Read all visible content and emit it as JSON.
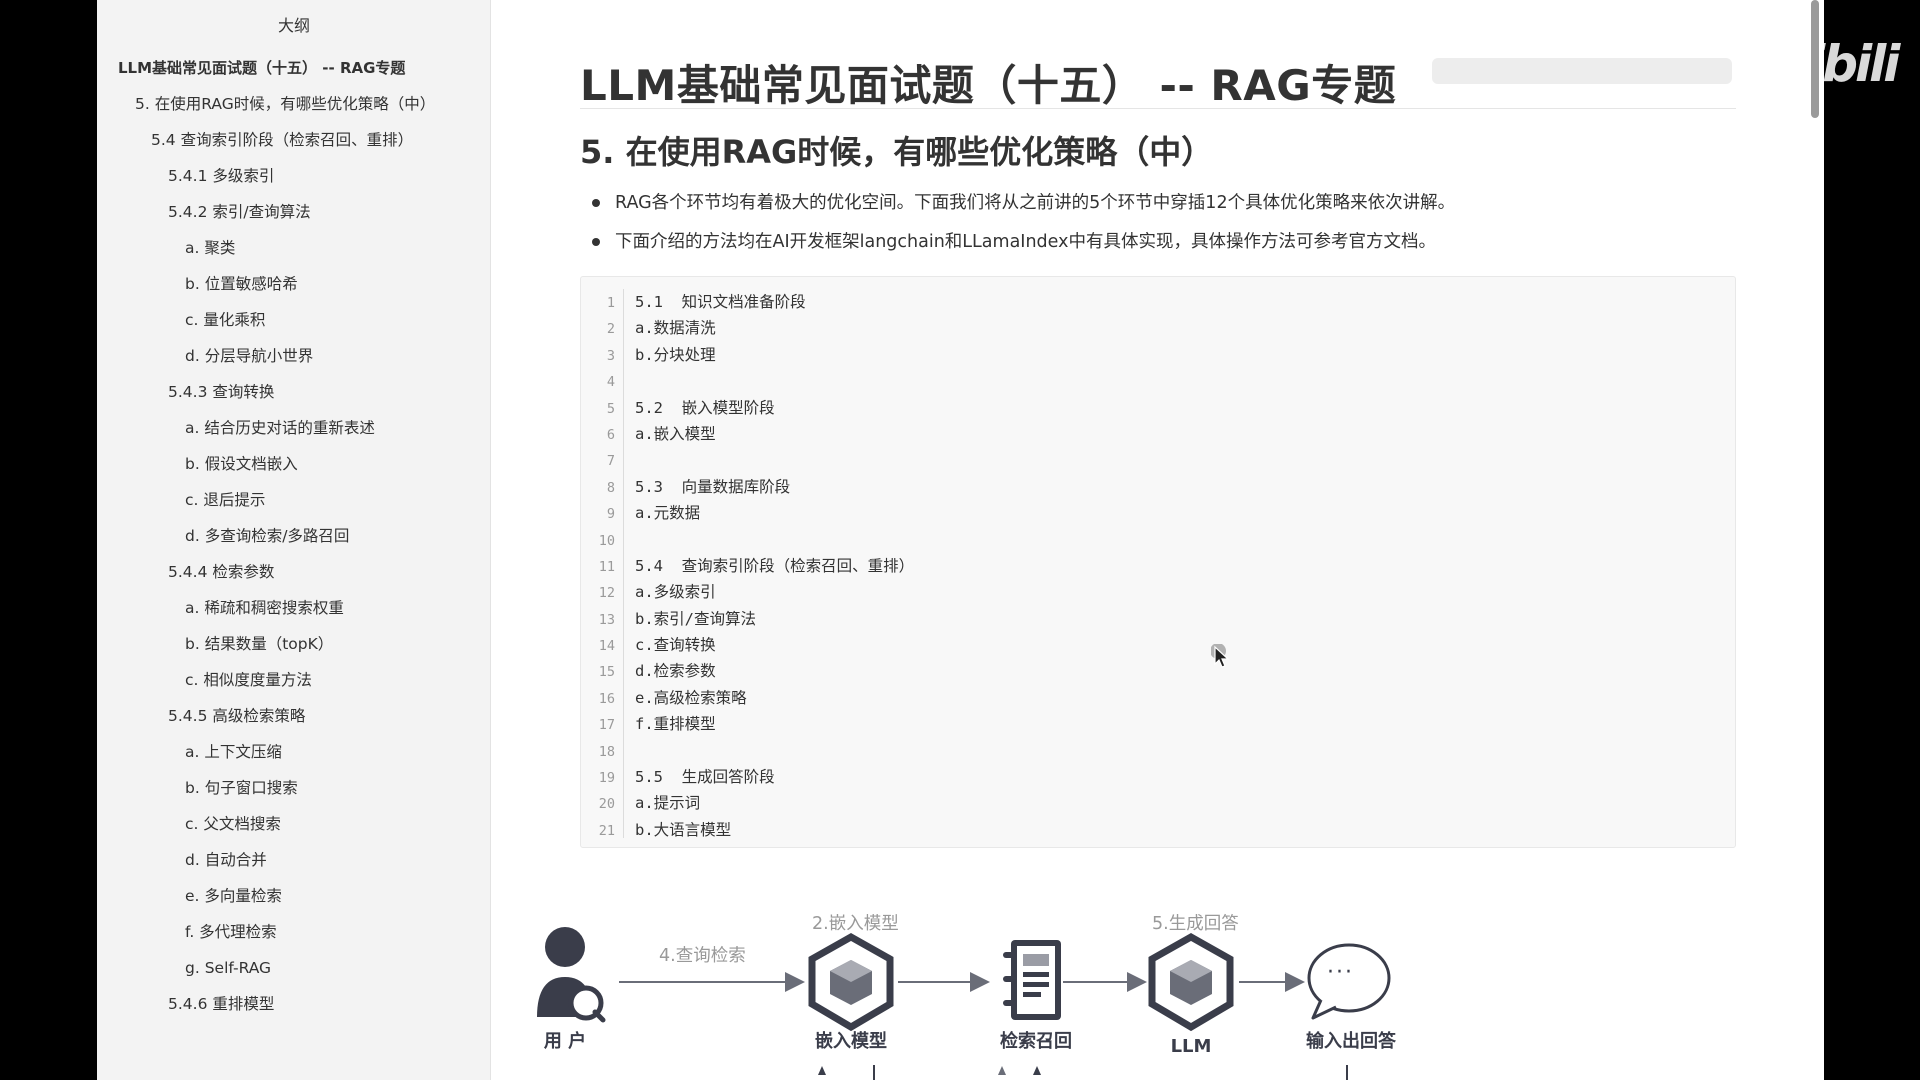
{
  "sidebar": {
    "title": "大纲",
    "items": [
      {
        "label": "LLM基础常见面试题（十五） -- RAG专题",
        "level": 0
      },
      {
        "label": "5. 在使用RAG时候，有哪些优化策略（中）",
        "level": 1
      },
      {
        "label": "5.4 查询索引阶段（检索召回、重排）",
        "level": 2
      },
      {
        "label": "5.4.1 多级索引",
        "level": 3
      },
      {
        "label": "5.4.2 索引/查询算法",
        "level": 3
      },
      {
        "label": "a. 聚类",
        "level": 4
      },
      {
        "label": "b. 位置敏感哈希",
        "level": 4
      },
      {
        "label": "c. 量化乘积",
        "level": 4
      },
      {
        "label": "d. 分层导航小世界",
        "level": 4
      },
      {
        "label": "5.4.3 查询转换",
        "level": 3
      },
      {
        "label": "a. 结合历史对话的重新表述",
        "level": 4
      },
      {
        "label": "b. 假设文档嵌入",
        "level": 4
      },
      {
        "label": "c. 退后提示",
        "level": 4
      },
      {
        "label": "d. 多查询检索/多路召回",
        "level": 4
      },
      {
        "label": "5.4.4 检索参数",
        "level": 3
      },
      {
        "label": "a. 稀疏和稠密搜索权重",
        "level": 4
      },
      {
        "label": "b. 结果数量（topK）",
        "level": 4
      },
      {
        "label": "c. 相似度度量方法",
        "level": 4
      },
      {
        "label": "5.4.5 高级检索策略",
        "level": 3
      },
      {
        "label": "a. 上下文压缩",
        "level": 4
      },
      {
        "label": "b. 句子窗口搜索",
        "level": 4
      },
      {
        "label": "c. 父文档搜索",
        "level": 4
      },
      {
        "label": "d. 自动合并",
        "level": 4
      },
      {
        "label": "e. 多向量检索",
        "level": 4
      },
      {
        "label": "f. 多代理检索",
        "level": 4
      },
      {
        "label": "g. Self-RAG",
        "level": 4
      },
      {
        "label": "5.4.6 重排模型",
        "level": 3
      }
    ]
  },
  "main": {
    "title": "LLM基础常见面试题（十五） -- RAG专题",
    "section_heading": "5. 在使用RAG时候，有哪些优化策略（中）",
    "bullets": [
      "RAG各个环节均有着极大的优化空间。下面我们将从之前讲的5个环节中穿插12个具体优化策略来依次讲解。",
      "下面介绍的方法均在AI开发框架langchain和LLamaIndex中有具体实现，具体操作方法可参考官方文档。"
    ],
    "code_lines": [
      "5.1  知识文档准备阶段",
      "a.数据清洗",
      "b.分块处理",
      "",
      "5.2  嵌入模型阶段",
      "a.嵌入模型",
      "",
      "5.3  向量数据库阶段",
      "a.元数据",
      "",
      "5.4  查询索引阶段（检索召回、重排）",
      "a.多级索引",
      "b.索引/查询算法",
      "c.查询转换",
      "d.检索参数",
      "e.高级检索策略",
      "f.重排模型",
      "",
      "5.5  生成回答阶段",
      "a.提示词",
      "b.大语言模型"
    ]
  },
  "diagram": {
    "step_labels": {
      "query": "4.查询检索",
      "embed": "2.嵌入模型",
      "generate": "5.生成回答"
    },
    "nodes": {
      "user": "用 户",
      "embedding_model": "嵌入模型",
      "retrieval": "检索召回",
      "llm": "LLM",
      "output": "输入出回答"
    },
    "output_bubble_text": "···"
  },
  "watermark": "bilibili",
  "colors": {
    "node_dark": "#3a3d4a",
    "arrow": "#6a6d78",
    "sidebar_bg": "#f3f3f3",
    "code_bg": "#f8f8f8"
  }
}
